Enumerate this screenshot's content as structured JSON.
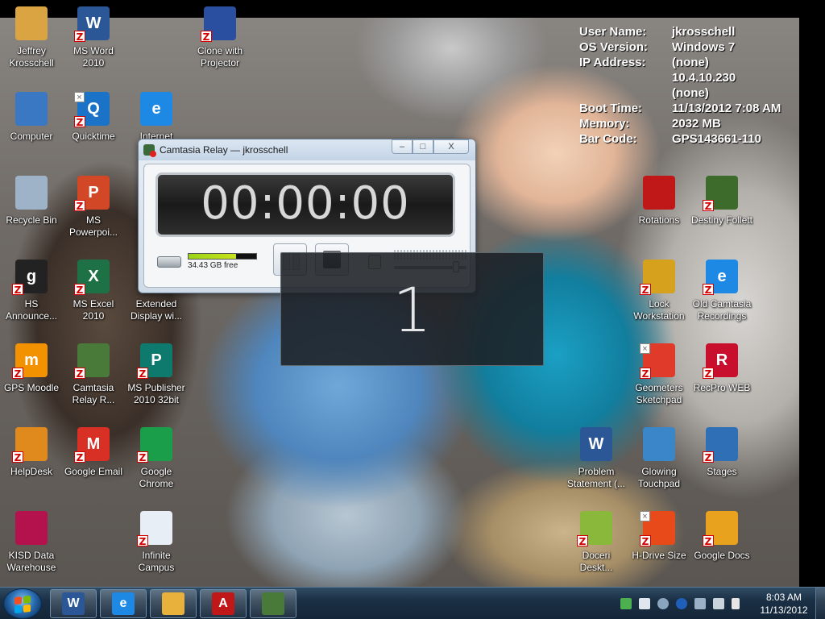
{
  "system_info": [
    {
      "label": "User Name:",
      "value": "jkrosschell"
    },
    {
      "label": "OS Version:",
      "value": "Windows 7"
    },
    {
      "label": "IP Address:",
      "value": "(none)"
    },
    {
      "label": "",
      "value": "10.4.10.230"
    },
    {
      "label": "",
      "value": "(none)"
    },
    {
      "label": "Boot Time:",
      "value": "11/13/2012 7:08 AM"
    },
    {
      "label": "Memory:",
      "value": "2032 MB"
    },
    {
      "label": "Bar Code:",
      "value": "GPS143661-110"
    }
  ],
  "desktop_icons": [
    {
      "label": "Jeffrey Krosschell",
      "icon": "user-folder-icon",
      "color": "#d9a441"
    },
    {
      "label": "MS Word 2010",
      "icon": "word-icon",
      "color": "#2b5797",
      "glyph": "W"
    },
    {
      "label": "Clone with Projector",
      "icon": "display-clone-icon",
      "color": "#2a4fa0"
    },
    {
      "label": "Computer",
      "icon": "computer-icon",
      "color": "#3b78c4"
    },
    {
      "label": "Quicktime",
      "icon": "quicktime-icon",
      "color": "#1a73c7",
      "glyph": "Q"
    },
    {
      "label": "Internet",
      "icon": "internet-explorer-icon",
      "color": "#1e88e5",
      "glyph": "e"
    },
    {
      "label": "Recycle Bin",
      "icon": "recycle-bin-icon",
      "color": "#9fb3c8"
    },
    {
      "label": "MS Powerpoi...",
      "icon": "powerpoint-icon",
      "color": "#d24726",
      "glyph": "P"
    },
    {
      "label": "HS Announce...",
      "icon": "hs-announce-icon",
      "color": "#222222",
      "glyph": "g"
    },
    {
      "label": "MS Excel 2010",
      "icon": "excel-icon",
      "color": "#1e7145",
      "glyph": "X"
    },
    {
      "label": "Extended Display wi...",
      "icon": "display-extend-icon",
      "color": "#2a4fa0"
    },
    {
      "label": "GPS Moodle",
      "icon": "moodle-icon",
      "color": "#f39200",
      "glyph": "m"
    },
    {
      "label": "Camtasia Relay R...",
      "icon": "camtasia-relay-icon",
      "color": "#4a7a3a"
    },
    {
      "label": "MS Publisher 2010 32bit",
      "icon": "publisher-icon",
      "color": "#0e7a6e",
      "glyph": "P"
    },
    {
      "label": "HelpDesk",
      "icon": "helpdesk-icon",
      "color": "#e08a1e"
    },
    {
      "label": "Google Email",
      "icon": "gmail-icon",
      "color": "#d93025",
      "glyph": "M"
    },
    {
      "label": "Google Chrome",
      "icon": "chrome-icon",
      "color": "#1a9e4a"
    },
    {
      "label": "KISD Data Warehouse",
      "icon": "kisd-data-icon",
      "color": "#b3124c"
    },
    {
      "label": "Infinite Campus",
      "icon": "infinite-campus-icon",
      "color": "#e8eef5"
    },
    {
      "label": "Rotations",
      "icon": "pdf-icon",
      "color": "#c01818"
    },
    {
      "label": "Destiny Follett",
      "icon": "destiny-tree-icon",
      "color": "#3d6b2b"
    },
    {
      "label": "Lock Workstation",
      "icon": "lock-icon",
      "color": "#d6a21e"
    },
    {
      "label": "Old Camtasia Recordings",
      "icon": "internet-explorer-icon",
      "color": "#1e88e5",
      "glyph": "e"
    },
    {
      "label": "Geometers Sketchpad",
      "icon": "sketchpad-icon",
      "color": "#e03a2a"
    },
    {
      "label": "RecPro WEB",
      "icon": "recpro-icon",
      "color": "#c8102e",
      "glyph": "R"
    },
    {
      "label": "Problem Statement (...",
      "icon": "word-doc-icon",
      "color": "#2b5797",
      "glyph": "W"
    },
    {
      "label": "Glowing Touchpad",
      "icon": "touchpad-icon",
      "color": "#3a86c8"
    },
    {
      "label": "Stages",
      "icon": "stages-icon",
      "color": "#2f6fb5"
    },
    {
      "label": "Doceri Deskt...",
      "icon": "doceri-icon",
      "color": "#8ab83a"
    },
    {
      "label": "H-Drive Size",
      "icon": "pie-chart-icon",
      "color": "#e84a1a"
    },
    {
      "label": "Google Docs",
      "icon": "google-docs-icon",
      "color": "#e8a21e"
    }
  ],
  "camtasia": {
    "title": "Camtasia Relay — jkrosschell",
    "minimize": "–",
    "maximize": "□",
    "close": "X",
    "timer": "00:00:00",
    "disk_free": "34.43 GB free",
    "disk_used_fraction": 0.7,
    "mic_level_fraction": 0.85
  },
  "countdown": {
    "value": "1"
  },
  "taskbar": {
    "pinned": [
      {
        "name": "word-icon",
        "color": "#2b5797",
        "glyph": "W"
      },
      {
        "name": "internet-explorer-icon",
        "color": "#1e88e5",
        "glyph": "e"
      },
      {
        "name": "explorer-folder-icon",
        "color": "#e8b13b",
        "glyph": ""
      },
      {
        "name": "acrobat-pdf-icon",
        "color": "#c01818",
        "glyph": "A"
      },
      {
        "name": "camtasia-relay-icon",
        "color": "#4a7a3a",
        "glyph": ""
      }
    ],
    "clock_time": "8:03 AM",
    "clock_date": "11/13/2012"
  }
}
